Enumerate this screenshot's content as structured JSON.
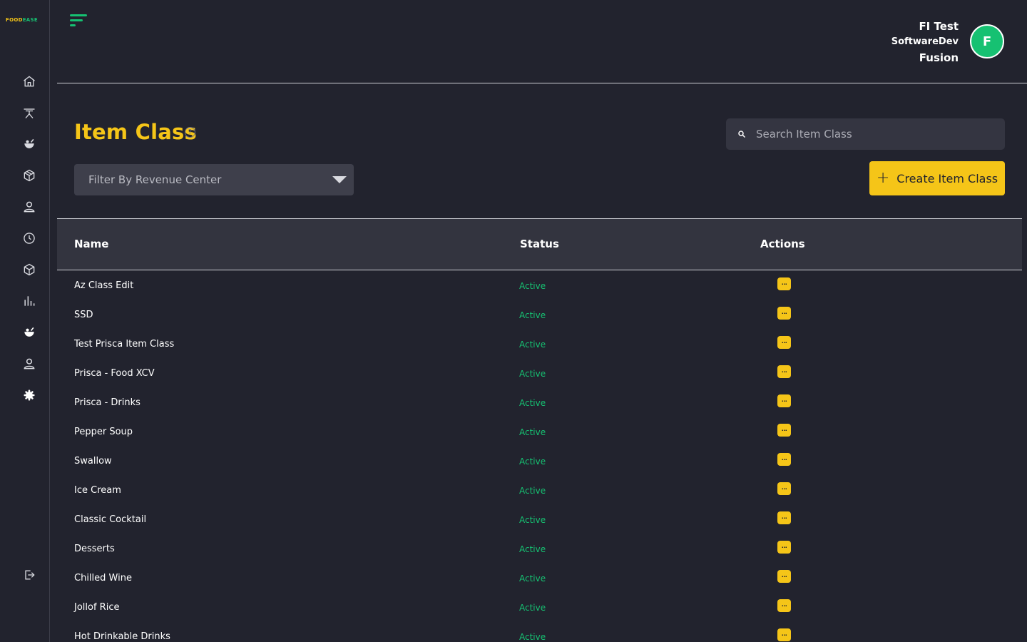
{
  "app": {
    "logo_part1": "FOOD",
    "logo_part2": "EASE"
  },
  "user": {
    "name": "FI Test",
    "role": "SoftwareDev",
    "company": "Fusion",
    "avatar_letter": "F"
  },
  "page": {
    "title": "Item Class"
  },
  "search": {
    "placeholder": "Search Item Class"
  },
  "filter": {
    "label": "Filter By Revenue Center"
  },
  "create_button": {
    "label": "Create Item Class"
  },
  "table": {
    "columns": [
      "Name",
      "Status",
      "Actions"
    ],
    "rows": [
      {
        "name": "Az Class Edit",
        "status": "Active"
      },
      {
        "name": "SSD",
        "status": "Active"
      },
      {
        "name": "Test Prisca Item Class",
        "status": "Active"
      },
      {
        "name": "Prisca - Food XCV",
        "status": "Active"
      },
      {
        "name": "Prisca - Drinks",
        "status": "Active"
      },
      {
        "name": "Pepper Soup",
        "status": "Active"
      },
      {
        "name": "Swallow",
        "status": "Active"
      },
      {
        "name": "Ice Cream",
        "status": "Active"
      },
      {
        "name": "Classic Cocktail",
        "status": "Active"
      },
      {
        "name": "Desserts",
        "status": "Active"
      },
      {
        "name": "Chilled Wine",
        "status": "Active"
      },
      {
        "name": "Jollof Rice",
        "status": "Active"
      },
      {
        "name": "Hot Drinkable Drinks",
        "status": "Active"
      }
    ],
    "action_glyph": "···"
  },
  "sidebar": {
    "items": [
      {
        "icon": "home-icon"
      },
      {
        "icon": "dining-table-icon"
      },
      {
        "icon": "food-icon"
      },
      {
        "icon": "package-icon"
      },
      {
        "icon": "user-icon"
      },
      {
        "icon": "clock-icon"
      },
      {
        "icon": "box-icon"
      },
      {
        "icon": "bar-chart-icon"
      },
      {
        "icon": "food-filled-icon"
      },
      {
        "icon": "user-outline-icon"
      },
      {
        "icon": "settings-icon"
      },
      {
        "icon": "logout-icon"
      }
    ]
  },
  "colors": {
    "background": "#22232e",
    "accent_yellow": "#f5c518",
    "accent_green": "#16c172",
    "table_header": "#33343f"
  }
}
